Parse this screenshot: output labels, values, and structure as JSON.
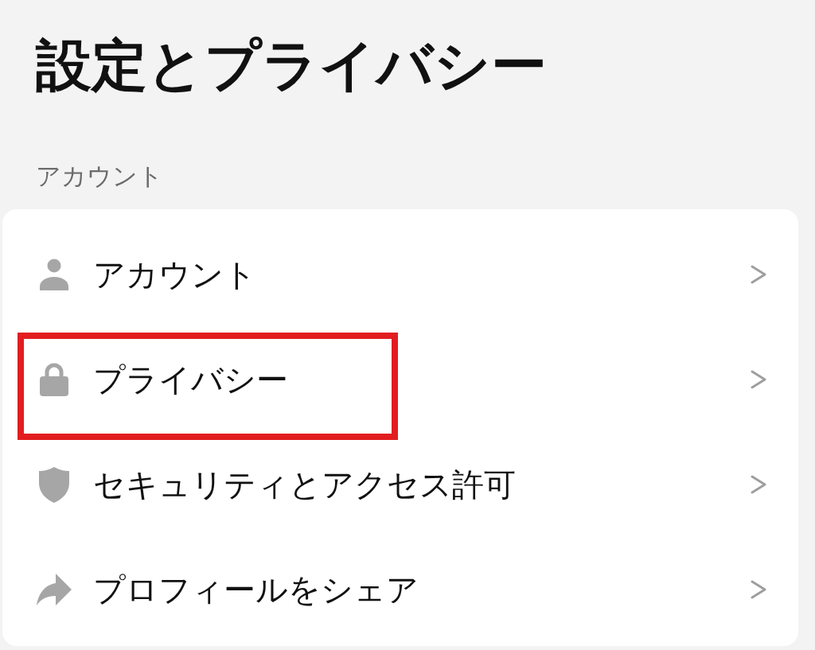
{
  "page": {
    "title": "設定とプライバシー"
  },
  "sections": [
    {
      "label": "アカウント",
      "items": [
        {
          "label": "アカウント",
          "highlighted": false
        },
        {
          "label": "プライバシー",
          "highlighted": true
        },
        {
          "label": "セキュリティとアクセス許可",
          "highlighted": false
        },
        {
          "label": "プロフィールをシェア",
          "highlighted": false
        }
      ]
    }
  ]
}
